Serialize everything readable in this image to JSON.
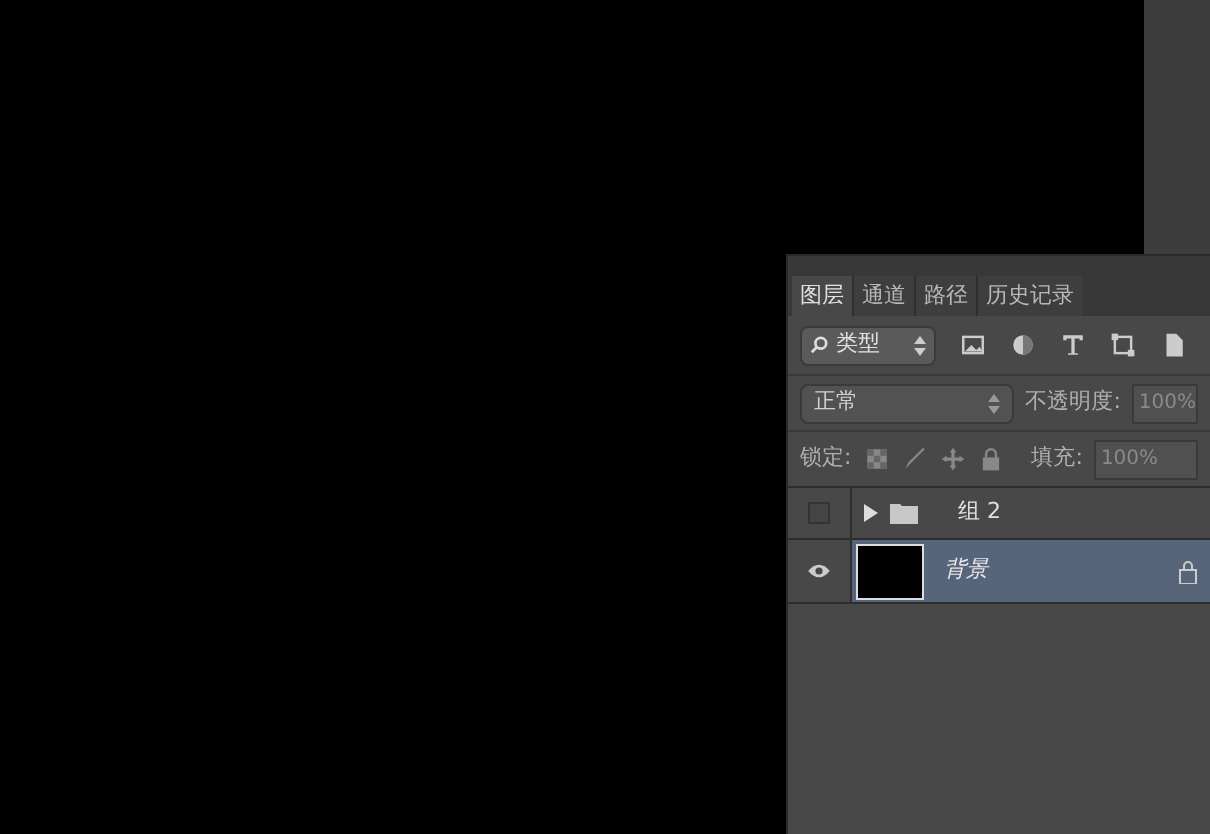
{
  "tabs": [
    {
      "label": "图层",
      "selected": true
    },
    {
      "label": "通道",
      "selected": false
    },
    {
      "label": "路径",
      "selected": false
    },
    {
      "label": "历史记录",
      "selected": false
    }
  ],
  "filter": {
    "value": "类型"
  },
  "blend_mode": {
    "value": "正常"
  },
  "opacity": {
    "label": "不透明度:",
    "value": "100%"
  },
  "lock": {
    "label": "锁定:"
  },
  "fill": {
    "label": "填充:",
    "value": "100%"
  },
  "layers": [
    {
      "name": "组 2",
      "kind": "group",
      "visible": false,
      "expanded": false,
      "selected": false,
      "locked": false
    },
    {
      "name": "背景",
      "kind": "image",
      "visible": true,
      "selected": true,
      "locked": true
    }
  ]
}
